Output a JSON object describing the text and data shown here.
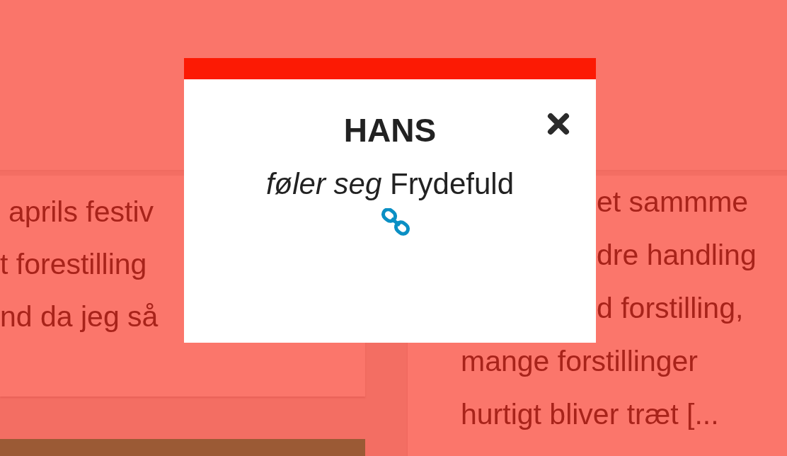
{
  "background": {
    "left_card": {
      "lines": [
        {
          "text": "aprils festiv",
          "kind": "partial"
        },
        {
          "text": "t forestilling",
          "kind": "full"
        },
        {
          "text": "nd da jeg så",
          "kind": "full"
        }
      ]
    },
    "right_card": {
      "lines": [
        {
          "text": "et sammme",
          "kind": "partial"
        },
        {
          "text": "dre handling",
          "kind": "partial"
        },
        {
          "text": "d forstilling,",
          "kind": "partial"
        },
        {
          "text": "mange forstillinger",
          "kind": "full"
        },
        {
          "text": "hurtigt bliver træt [...",
          "kind": "full"
        }
      ]
    }
  },
  "modal": {
    "title": "HANS",
    "text": "*føler seg* Frydefuld"
  }
}
